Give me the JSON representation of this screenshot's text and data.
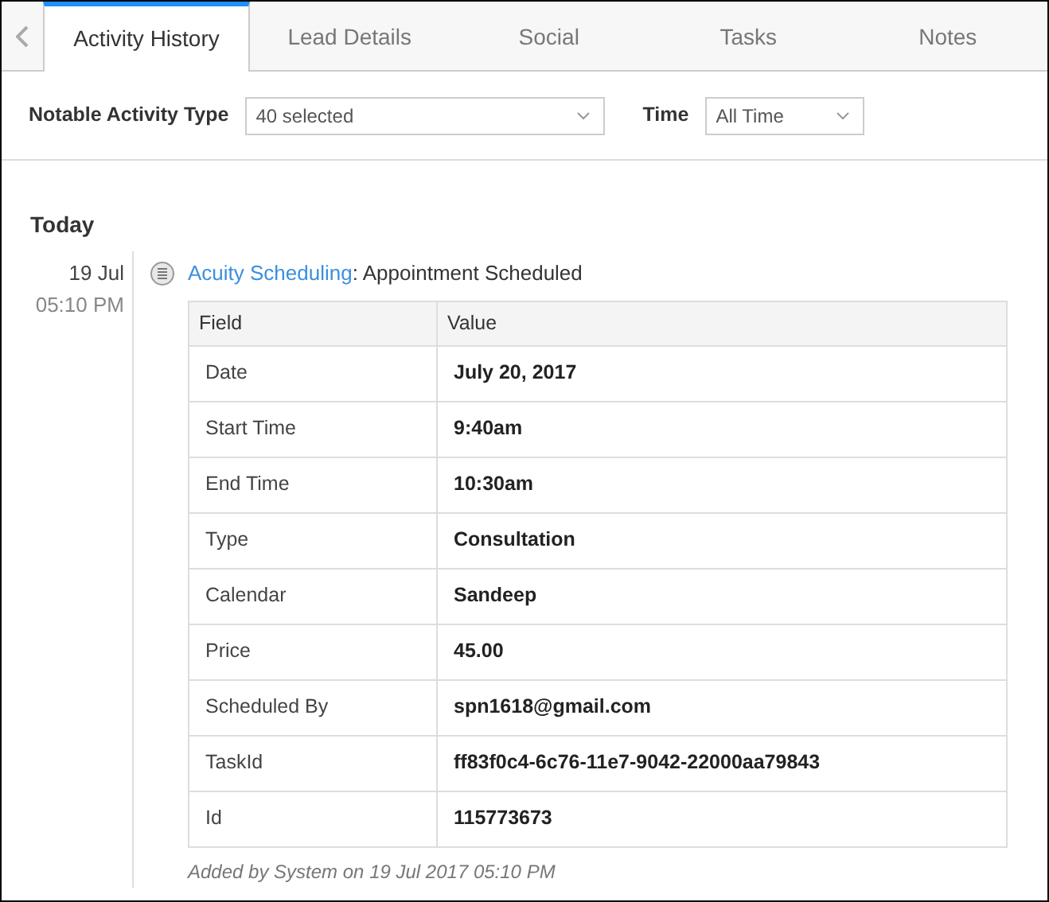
{
  "tabs": [
    {
      "label": "Activity History",
      "selected": true
    },
    {
      "label": "Lead Details",
      "selected": false
    },
    {
      "label": "Social",
      "selected": false
    },
    {
      "label": "Tasks",
      "selected": false
    },
    {
      "label": "Notes",
      "selected": false
    }
  ],
  "filters": [
    {
      "label": "Notable Activity Type",
      "value": "40 selected"
    },
    {
      "label": "Time",
      "value": "All Time"
    }
  ],
  "group": {
    "heading": "Today",
    "activity": {
      "date": "19 Jul",
      "time": "05:10 PM",
      "source": "Acuity Scheduling",
      "separator": ":",
      "title": " Appointment Scheduled",
      "table": {
        "columns": [
          "Field",
          "Value"
        ],
        "rows": [
          [
            "Date",
            "July 20, 2017"
          ],
          [
            "Start Time",
            "9:40am"
          ],
          [
            "End Time",
            "10:30am"
          ],
          [
            "Type",
            "Consultation"
          ],
          [
            "Calendar",
            "Sandeep"
          ],
          [
            "Price",
            "45.00"
          ],
          [
            "Scheduled By",
            "spn1618@gmail.com"
          ],
          [
            "TaskId",
            "ff83f0c4-6c76-11e7-9042-22000aa79843"
          ],
          [
            "Id",
            "115773673"
          ]
        ]
      },
      "footer": "Added by System on 19 Jul 2017 05:10 PM"
    }
  }
}
